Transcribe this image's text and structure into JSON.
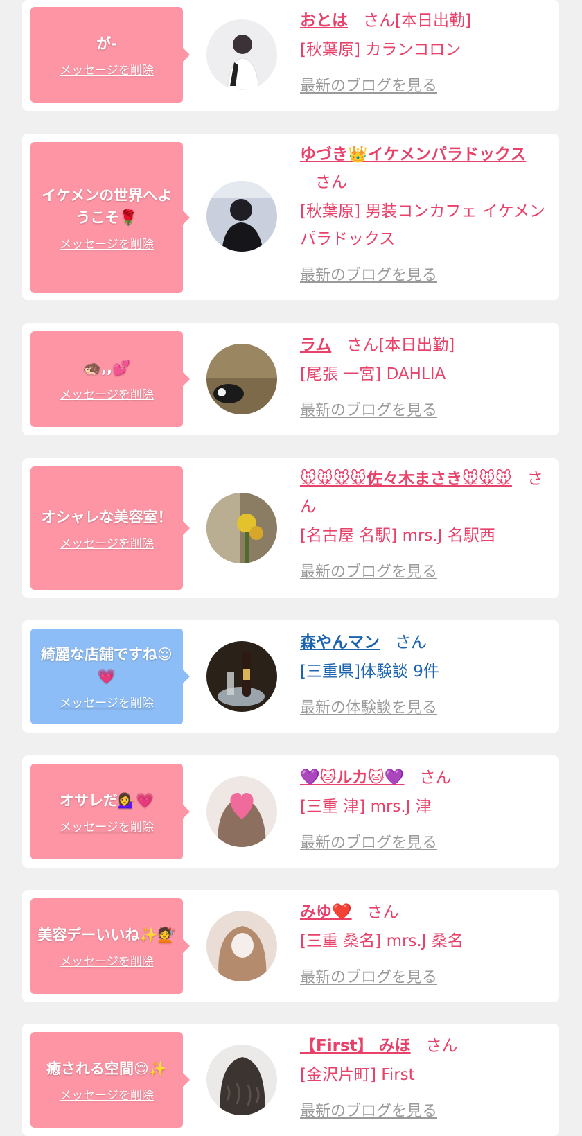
{
  "delete_label": "メッセージを削除",
  "blog_label": "最新のブログを見る",
  "review_label": "最新の体験談を見る",
  "san": "さん",
  "items": [
    {
      "message": "が-",
      "name": "おとは",
      "suffix": "[本日出勤]",
      "shop": "[秋葉原] カランコロン"
    },
    {
      "message": "イケメンの世界へようこそ🌹",
      "name": "ゆづき👑イケメンパラドックス",
      "suffix": "",
      "shop": "[秋葉原] 男装コンカフェ イケメンパラドックス"
    },
    {
      "message": "🦔,,💕",
      "name": "ラム",
      "suffix": "[本日出勤]",
      "shop": "[尾張 一宮] DAHLIA"
    },
    {
      "message": "オシャレな美容室！",
      "name": "🐭🐭🐭🐭佐々木まさき🐭🐭🐭",
      "suffix": "",
      "shop": "[名古屋 名駅] mrs.J 名駅西"
    },
    {
      "message": "綺麗な店舗ですね😌💗",
      "name": "森やんマン",
      "suffix": "",
      "shop": "[三重県]体験談 9件"
    },
    {
      "message": "オサレだ💁‍♀️💗",
      "name": "💜🐱ルカ🐱💜",
      "suffix": "",
      "shop": "[三重 津] mrs.J 津"
    },
    {
      "message": "美容デーいいね✨💇",
      "name": "みゆ❤️",
      "suffix": "",
      "shop": "[三重 桑名] mrs.J 桑名"
    },
    {
      "message": "癒される空間😌✨",
      "name": "【First】 みほ",
      "suffix": "",
      "shop": "[金沢片町] First"
    }
  ],
  "colors": {
    "pink_bubble": "#fd95a5",
    "blue_bubble": "#8dbdf6",
    "pink_text": "#e8416a",
    "blue_text": "#1c64b0",
    "link_gray": "#9a9a9a"
  }
}
